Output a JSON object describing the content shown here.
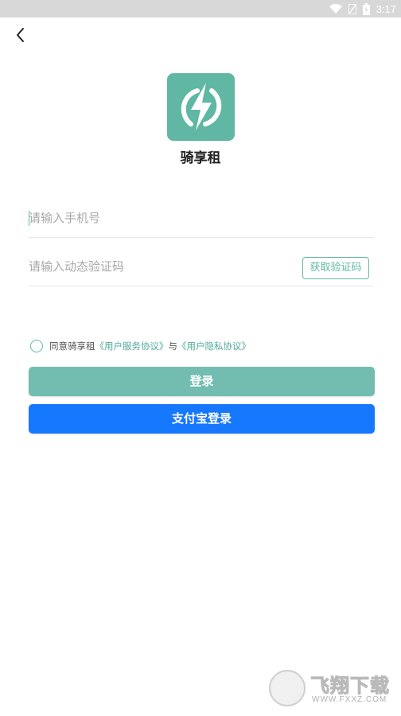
{
  "status_bar": {
    "time": "3:17",
    "icons": [
      "wifi-icon",
      "sim-icon",
      "battery-icon"
    ]
  },
  "header": {
    "back_icon": "chevron-left-icon"
  },
  "app": {
    "name": "骑享租",
    "logo_icon": "lightning-bolt-icon",
    "logo_color": "#5fb7a4"
  },
  "form": {
    "phone_placeholder": "请输入手机号",
    "code_placeholder": "请输入动态验证码",
    "get_code_label": "获取验证码"
  },
  "agreement": {
    "prefix": "同意骑享租",
    "service_link": "《用户服务协议》",
    "connector": "与",
    "privacy_link": "《用户隐私协议》"
  },
  "buttons": {
    "login_label": "登录",
    "alipay_login_label": "支付宝登录"
  },
  "colors": {
    "accent": "#62b8a6",
    "login_button": "#72bcb0",
    "alipay_button": "#1677ff"
  },
  "watermark": {
    "title": "飞翔下载",
    "url": "WWW.FXXZ.COM"
  }
}
